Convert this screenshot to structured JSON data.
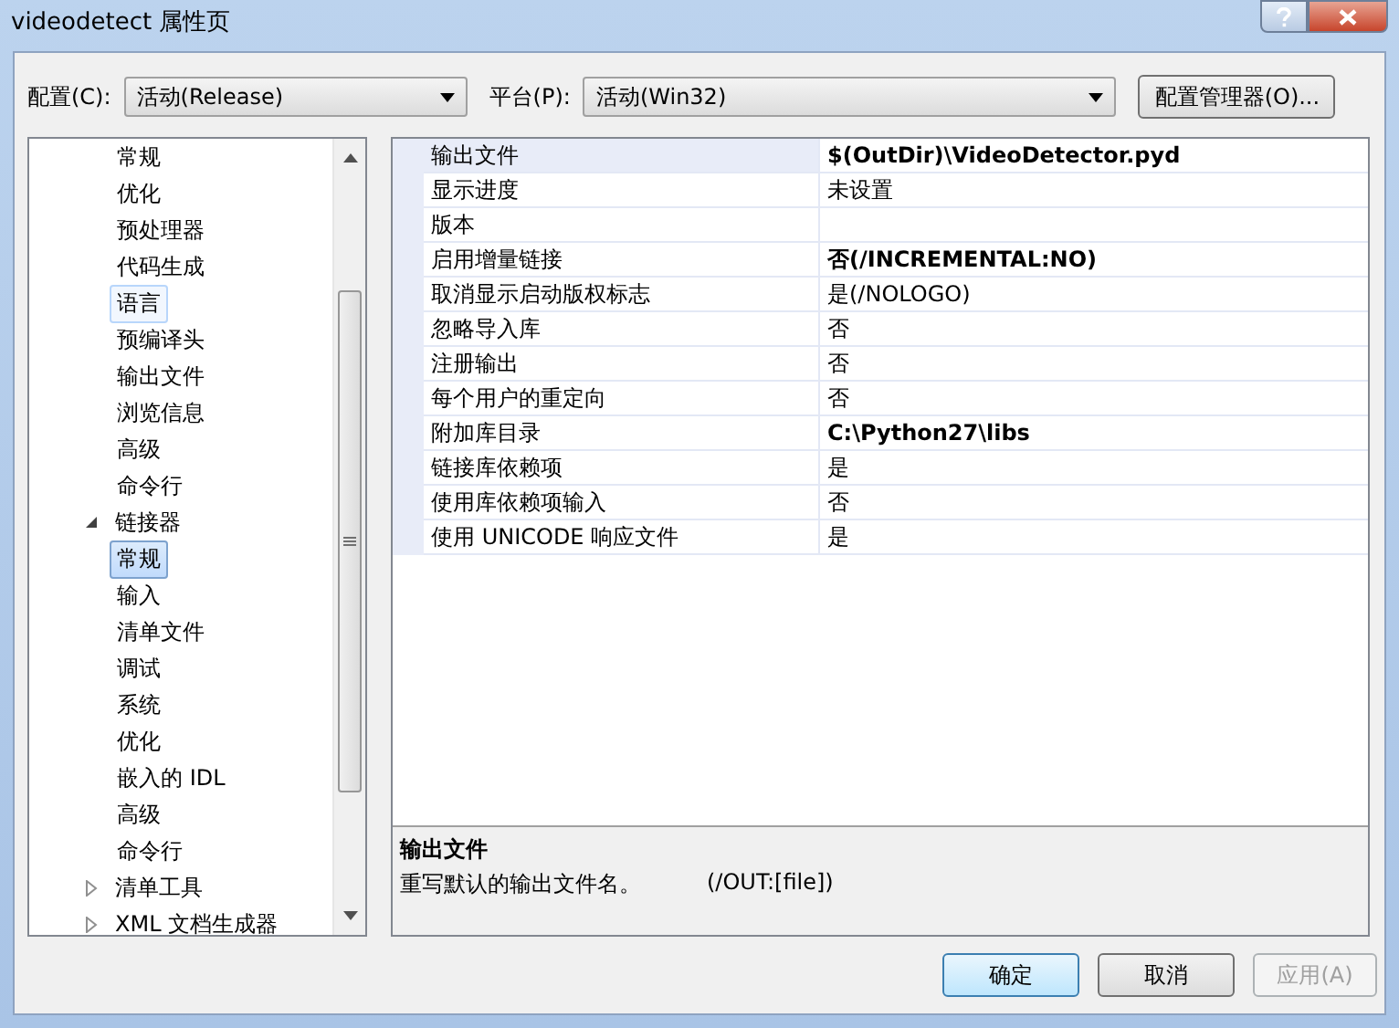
{
  "window": {
    "title": "videodetect 属性页"
  },
  "toolbar": {
    "config_label": "配置(C):",
    "config_value": "活动(Release)",
    "platform_label": "平台(P):",
    "platform_value": "活动(Win32)",
    "manager_button": "配置管理器(O)..."
  },
  "tree": [
    {
      "children": [
        {
          "label": "常规",
          "selected": false,
          "hovered": false
        },
        {
          "label": "优化",
          "selected": false,
          "hovered": false
        },
        {
          "label": "预处理器",
          "selected": false,
          "hovered": false
        },
        {
          "label": "代码生成",
          "selected": false,
          "hovered": false
        },
        {
          "label": "语言",
          "selected": false,
          "hovered": true
        },
        {
          "label": "预编译头",
          "selected": false,
          "hovered": false
        },
        {
          "label": "输出文件",
          "selected": false,
          "hovered": false
        },
        {
          "label": "浏览信息",
          "selected": false,
          "hovered": false
        },
        {
          "label": "高级",
          "selected": false,
          "hovered": false
        },
        {
          "label": "命令行",
          "selected": false,
          "hovered": false
        }
      ]
    },
    {
      "label": "链接器",
      "expanded": true,
      "children": [
        {
          "label": "常规",
          "selected": true,
          "hovered": false
        },
        {
          "label": "输入",
          "selected": false,
          "hovered": false
        },
        {
          "label": "清单文件",
          "selected": false,
          "hovered": false
        },
        {
          "label": "调试",
          "selected": false,
          "hovered": false
        },
        {
          "label": "系统",
          "selected": false,
          "hovered": false
        },
        {
          "label": "优化",
          "selected": false,
          "hovered": false
        },
        {
          "label": "嵌入的 IDL",
          "selected": false,
          "hovered": false
        },
        {
          "label": "高级",
          "selected": false,
          "hovered": false
        },
        {
          "label": "命令行",
          "selected": false,
          "hovered": false
        }
      ]
    },
    {
      "label": "清单工具",
      "expanded": false
    },
    {
      "label": "XML 文档生成器",
      "expanded": false
    }
  ],
  "properties": [
    {
      "name": "输出文件",
      "value": "$(OutDir)\\VideoDetector.pyd",
      "bold": true,
      "selected": true
    },
    {
      "name": "显示进度",
      "value": "未设置",
      "bold": false,
      "selected": false
    },
    {
      "name": "版本",
      "selected": false
    },
    {
      "name": "启用增量链接",
      "value": "否(/INCREMENTAL:NO)",
      "bold": true,
      "selected": false
    },
    {
      "name": "取消显示启动版权标志",
      "value": "是(/NOLOGO)",
      "bold": false,
      "selected": false
    },
    {
      "name": "忽略导入库",
      "value": "否",
      "bold": false,
      "selected": false
    },
    {
      "name": "注册输出",
      "value": "否",
      "bold": false,
      "selected": false
    },
    {
      "name": "每个用户的重定向",
      "value": "否",
      "bold": false,
      "selected": false
    },
    {
      "name": "附加库目录",
      "value": "C:\\Python27\\libs",
      "bold": true,
      "selected": false
    },
    {
      "name": "链接库依赖项",
      "value": "是",
      "bold": false,
      "selected": false
    },
    {
      "name": "使用库依赖项输入",
      "value": "否",
      "bold": false,
      "selected": false
    },
    {
      "name": "使用 UNICODE 响应文件",
      "value": "是",
      "bold": false,
      "selected": false
    }
  ],
  "description": {
    "title": "输出文件",
    "text": "重写默认的输出文件名。",
    "switch": "(/OUT:[file])"
  },
  "buttons": [
    {
      "label": "确定",
      "default": true,
      "disabled": false
    },
    {
      "label": "取消",
      "default": false,
      "disabled": false
    },
    {
      "label": "应用(A)",
      "default": false,
      "disabled": true
    }
  ]
}
